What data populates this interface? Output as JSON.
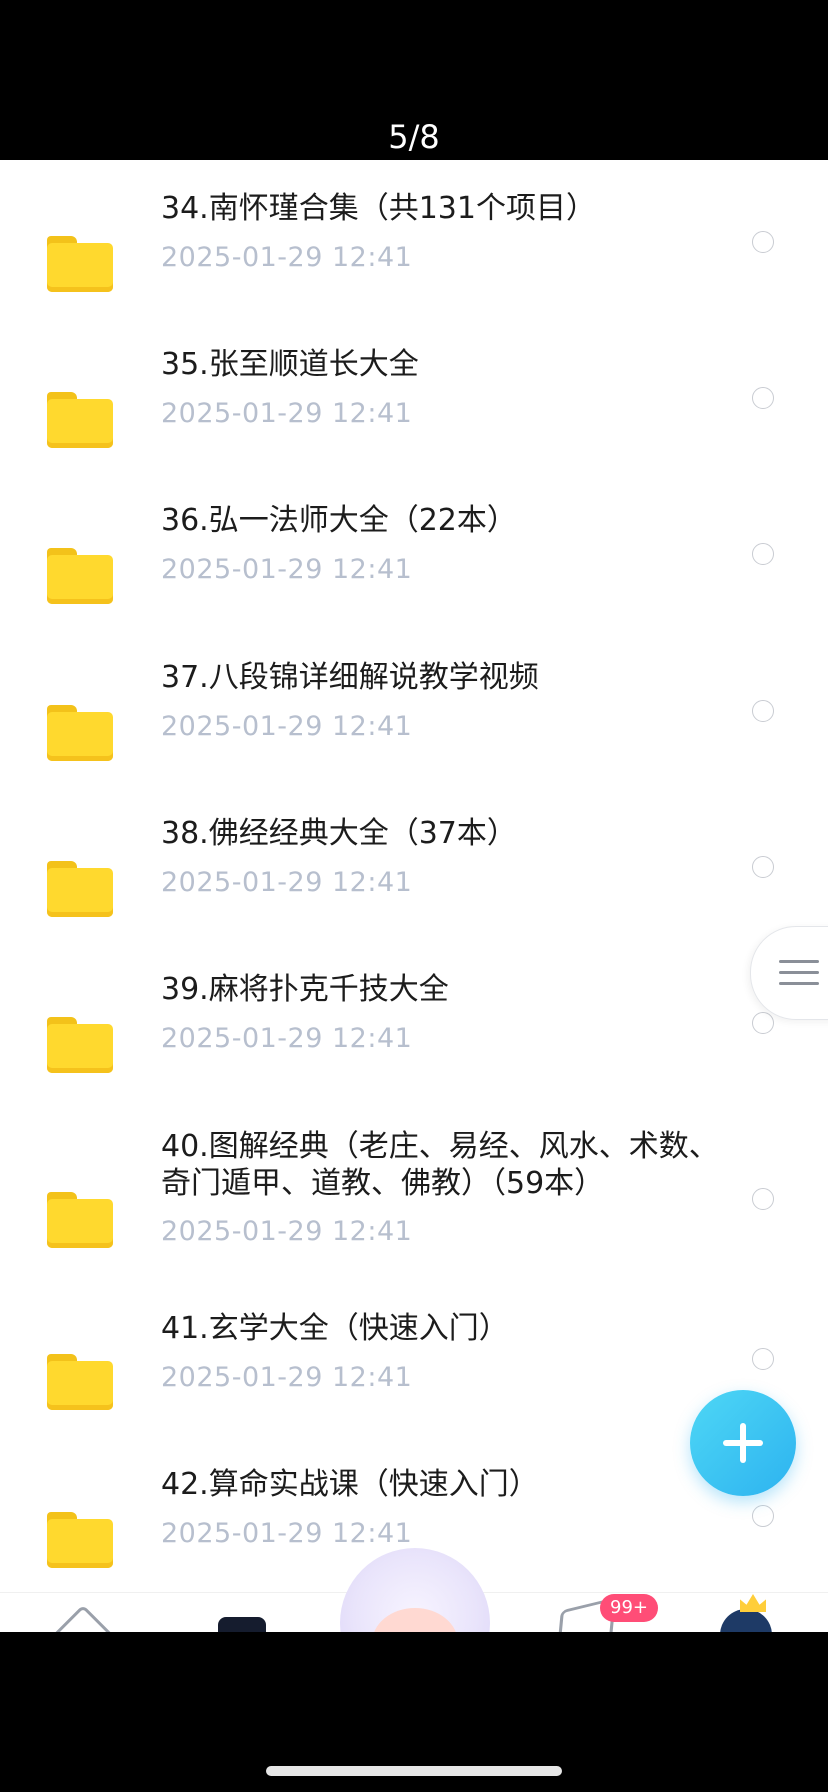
{
  "status": {
    "page_indicator": "5/8"
  },
  "items": [
    {
      "title": "34.南怀瑾合集（共131个项目）",
      "date": "2025-01-29  12:41"
    },
    {
      "title": "35.张至顺道长大全",
      "date": "2025-01-29  12:41"
    },
    {
      "title": "36.弘一法师大全（22本）",
      "date": "2025-01-29  12:41"
    },
    {
      "title": "37.八段锦详细解说教学视频",
      "date": "2025-01-29  12:41"
    },
    {
      "title": "38.佛经经典大全（37本）",
      "date": "2025-01-29  12:41"
    },
    {
      "title": "39.麻将扑克千技大全",
      "date": "2025-01-29  12:41"
    },
    {
      "title_line1": "40.图解经典（老庄、易经、风水、术数、",
      "title_line2": "奇门遁甲、道教、佛教）（59本）",
      "date": "2025-01-29  12:41"
    },
    {
      "title": "41.玄学大全（快速入门）",
      "date": "2025-01-29  12:41"
    },
    {
      "title": "42.算命实战课（快速入门）",
      "date": "2025-01-29  12:41"
    }
  ],
  "tabbar": {
    "badge": "99+"
  },
  "icons": {
    "folder": "folder-icon",
    "fab": "plus-icon",
    "side": "menu-lines-icon",
    "home": "home-icon",
    "files": "files-icon",
    "mascot": "mascot-icon",
    "send": "send-icon",
    "avatar": "avatar-icon"
  },
  "colors": {
    "folder": "#ffd92e",
    "fab": "#2db3f0",
    "badge": "#ff4d77",
    "date": "#b7bfce"
  }
}
